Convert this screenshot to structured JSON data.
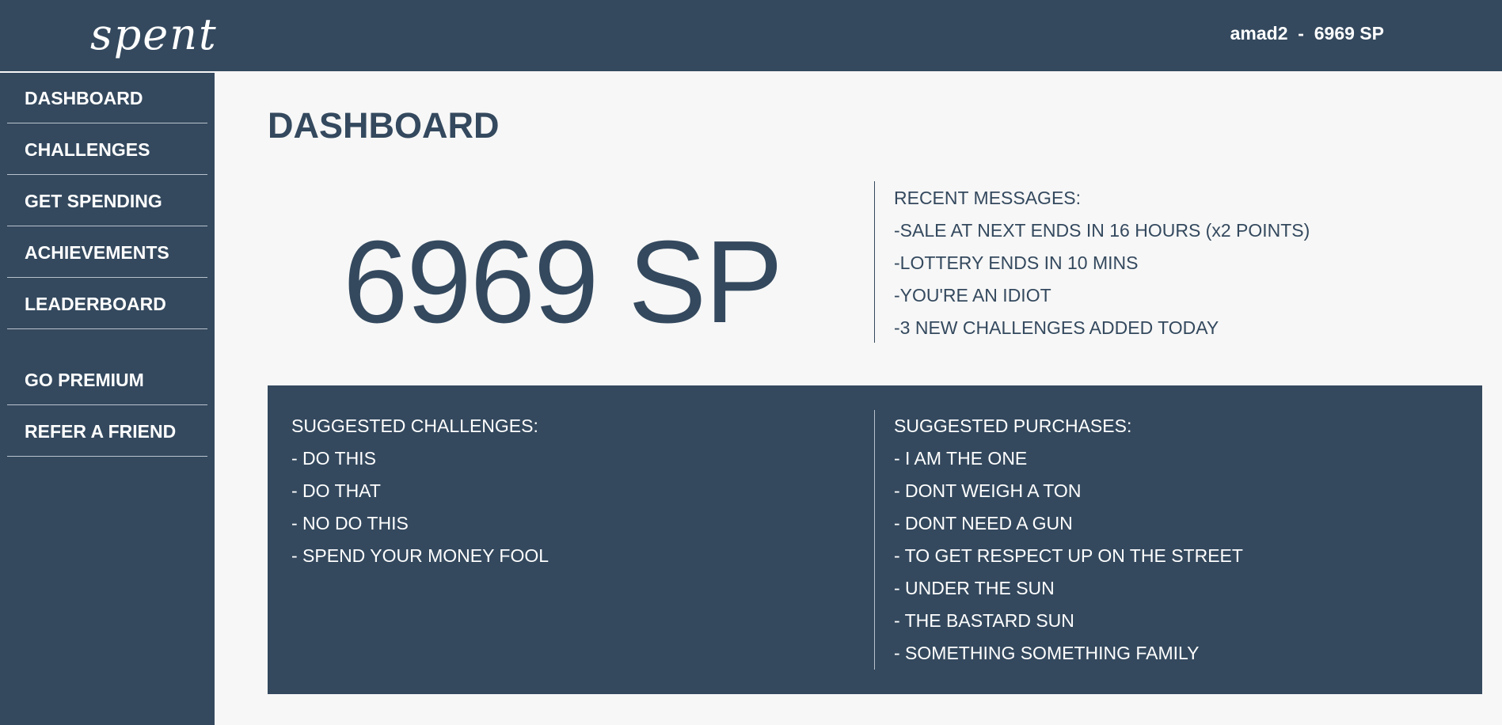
{
  "header": {
    "logo": "spent",
    "username": "amad2",
    "separator": "-",
    "points": "6969 SP"
  },
  "sidebar": {
    "items": [
      {
        "label": "DASHBOARD"
      },
      {
        "label": "CHALLENGES"
      },
      {
        "label": "GET SPENDING"
      },
      {
        "label": "ACHIEVEMENTS"
      },
      {
        "label": "LEADERBOARD"
      },
      {
        "label": "GO PREMIUM"
      },
      {
        "label": "REFER A FRIEND"
      }
    ]
  },
  "main": {
    "title": "DASHBOARD",
    "points_display": "6969 SP",
    "messages": {
      "heading": "RECENT MESSAGES:",
      "items": [
        "-SALE AT NEXT ENDS IN 16 HOURS (x2 POINTS)",
        "-LOTTERY ENDS IN 10 MINS",
        "-YOU'RE AN IDIOT",
        "-3 NEW CHALLENGES ADDED TODAY"
      ]
    },
    "suggested_challenges": {
      "heading": "SUGGESTED CHALLENGES:",
      "items": [
        "- DO THIS",
        "- DO THAT",
        "- NO DO THIS",
        "- SPEND YOUR MONEY FOOL"
      ]
    },
    "suggested_purchases": {
      "heading": "SUGGESTED PURCHASES:",
      "items": [
        "- I AM THE ONE",
        "- DONT WEIGH A TON",
        "- DONT NEED A GUN",
        "- TO GET RESPECT UP ON THE STREET",
        "- UNDER THE SUN",
        "- THE BASTARD SUN",
        "- SOMETHING SOMETHING FAMILY"
      ]
    }
  },
  "colors": {
    "primary": "#34495e",
    "background": "#f7f7f7",
    "text_light": "#ffffff"
  }
}
